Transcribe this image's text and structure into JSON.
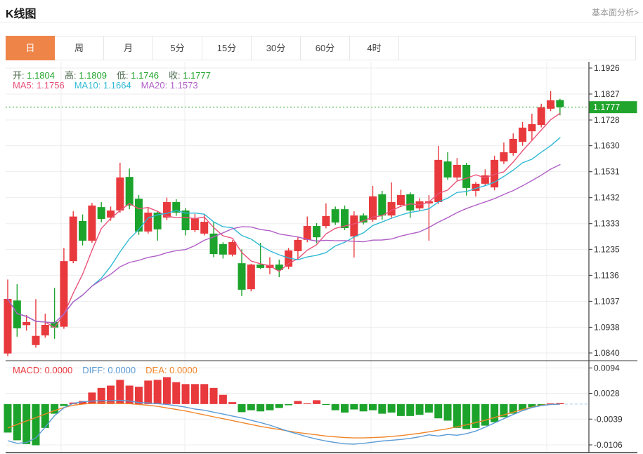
{
  "header": {
    "title": "K线图",
    "link_label": "基本面分析>"
  },
  "tabs": [
    {
      "name": "day",
      "label": "日",
      "selected": true
    },
    {
      "name": "week",
      "label": "周",
      "selected": false
    },
    {
      "name": "month",
      "label": "月",
      "selected": false
    },
    {
      "name": "m5",
      "label": "5分",
      "selected": false
    },
    {
      "name": "m15",
      "label": "15分",
      "selected": false
    },
    {
      "name": "m30",
      "label": "30分",
      "selected": false
    },
    {
      "name": "m60",
      "label": "60分",
      "selected": false
    },
    {
      "name": "h4",
      "label": "4时",
      "selected": false
    }
  ],
  "legend": {
    "ohlc": [
      {
        "label": "开:",
        "value": "1.1804"
      },
      {
        "label": "高:",
        "value": "1.1809"
      },
      {
        "label": "低:",
        "value": "1.1746"
      },
      {
        "label": "收:",
        "value": "1.1777"
      }
    ],
    "ma": [
      {
        "label": "MA5:",
        "value": "1.1756",
        "color": "#e9537a"
      },
      {
        "label": "MA10:",
        "value": "1.1664",
        "color": "#2fb9d4"
      },
      {
        "label": "MA20:",
        "value": "1.1573",
        "color": "#b05fc6"
      }
    ],
    "macd": [
      {
        "label": "MACD:",
        "value": "0.0000",
        "color": "#e8393d"
      },
      {
        "label": "DIFF:",
        "value": "0.0000",
        "color": "#5b9bd5"
      },
      {
        "label": "DEA:",
        "value": "0.0000",
        "color": "#f0862a"
      }
    ]
  },
  "colors": {
    "up": "#e8393d",
    "down": "#1ca32c",
    "ma5": "#e9537a",
    "ma10": "#2fb9d4",
    "ma20": "#b05fc6",
    "diff_line": "#5b9bd5",
    "dea_line": "#f0862a",
    "grid": "#ededed",
    "axis": "#3a3a3a",
    "tick_text": "#333333",
    "price_line": "#21a52d",
    "price_label_bg": "#21a52d",
    "ohlc_label": "#4d6b4f",
    "ohlc_value": "#21a52d",
    "dashed_zero": "#9cc8e8",
    "tab_selected_bg": "#ef8449"
  },
  "chart_data": {
    "type": "candlestick",
    "title": "K线图",
    "legend_position": "top-left",
    "grid": true,
    "main_pane": {
      "ylim": [
        1.084,
        1.1926
      ],
      "y_ticks": [
        1.1926,
        1.1827,
        1.1728,
        1.163,
        1.1531,
        1.1432,
        1.1333,
        1.1235,
        1.1136,
        1.1037,
        1.0938,
        1.084
      ],
      "last_price": 1.1777,
      "ma_periods": [
        5,
        10,
        20
      ],
      "ma_latest": {
        "MA5": 1.1756,
        "MA10": 1.1664,
        "MA20": 1.1573
      },
      "ohlc_display": {
        "open": 1.1804,
        "high": 1.1809,
        "low": 1.1746,
        "close": 1.1777
      },
      "candles_ohlc": [
        [
          1.0838,
          1.112,
          1.0828,
          1.1046
        ],
        [
          1.104,
          1.1102,
          1.0902,
          1.0934
        ],
        [
          1.0946,
          1.0985,
          1.0925,
          1.0958
        ],
        [
          1.087,
          1.1045,
          1.086,
          1.0905
        ],
        [
          1.0907,
          1.099,
          1.0898,
          1.0947
        ],
        [
          1.0958,
          1.1088,
          1.0894,
          1.0937
        ],
        [
          1.094,
          1.124,
          1.0932,
          1.119
        ],
        [
          1.119,
          1.138,
          1.1182,
          1.136
        ],
        [
          1.1343,
          1.1368,
          1.125,
          1.1268
        ],
        [
          1.1268,
          1.1412,
          1.126,
          1.1402
        ],
        [
          1.1396,
          1.1415,
          1.1338,
          1.1351
        ],
        [
          1.1356,
          1.1398,
          1.1344,
          1.1383
        ],
        [
          1.1383,
          1.1565,
          1.1375,
          1.1509
        ],
        [
          1.1511,
          1.1543,
          1.1388,
          1.1402
        ],
        [
          1.1428,
          1.1442,
          1.129,
          1.1303
        ],
        [
          1.1303,
          1.1392,
          1.1295,
          1.1375
        ],
        [
          1.1375,
          1.1382,
          1.1268,
          1.1311
        ],
        [
          1.1356,
          1.1432,
          1.1346,
          1.1415
        ],
        [
          1.1415,
          1.1426,
          1.1363,
          1.1375
        ],
        [
          1.1383,
          1.1392,
          1.1288,
          1.1308
        ],
        [
          1.1308,
          1.137,
          1.13,
          1.1352
        ],
        [
          1.1295,
          1.1368,
          1.1288,
          1.134
        ],
        [
          1.1295,
          1.134,
          1.1205,
          1.1217
        ],
        [
          1.1255,
          1.1262,
          1.12,
          1.1215
        ],
        [
          1.1215,
          1.127,
          1.1208,
          1.1263
        ],
        [
          1.1182,
          1.1235,
          1.1057,
          1.1081
        ],
        [
          1.1083,
          1.118,
          1.1075,
          1.1177
        ],
        [
          1.1177,
          1.126,
          1.116,
          1.1164
        ],
        [
          1.1164,
          1.1205,
          1.114,
          1.1176
        ],
        [
          1.1177,
          1.1196,
          1.1129,
          1.1156
        ],
        [
          1.1169,
          1.124,
          1.116,
          1.1231
        ],
        [
          1.1228,
          1.1282,
          1.1196,
          1.1271
        ],
        [
          1.1271,
          1.136,
          1.1262,
          1.1324
        ],
        [
          1.1324,
          1.1335,
          1.1258,
          1.1281
        ],
        [
          1.1324,
          1.141,
          1.1315,
          1.1362
        ],
        [
          1.1388,
          1.1398,
          1.1328,
          1.1337
        ],
        [
          1.1388,
          1.1402,
          1.1308,
          1.1316
        ],
        [
          1.1284,
          1.138,
          1.1204,
          1.1364
        ],
        [
          1.1364,
          1.1372,
          1.133,
          1.1337
        ],
        [
          1.1348,
          1.1477,
          1.134,
          1.1437
        ],
        [
          1.1445,
          1.1458,
          1.1348,
          1.1364
        ],
        [
          1.1364,
          1.149,
          1.1352,
          1.1415
        ],
        [
          1.1404,
          1.1462,
          1.1396,
          1.1442
        ],
        [
          1.1445,
          1.1452,
          1.1355,
          1.1383
        ],
        [
          1.1391,
          1.143,
          1.1382,
          1.1418
        ],
        [
          1.141,
          1.1442,
          1.1268,
          1.1418
        ],
        [
          1.1415,
          1.1629,
          1.1408,
          1.1576
        ],
        [
          1.157,
          1.1605,
          1.15,
          1.1509
        ],
        [
          1.1509,
          1.1583,
          1.1498,
          1.1557
        ],
        [
          1.1557,
          1.1565,
          1.144,
          1.1469
        ],
        [
          1.1458,
          1.1492,
          1.1436,
          1.1485
        ],
        [
          1.1485,
          1.154,
          1.1476,
          1.1517
        ],
        [
          1.1471,
          1.1592,
          1.146,
          1.1576
        ],
        [
          1.157,
          1.1642,
          1.156,
          1.1605
        ],
        [
          1.1602,
          1.1677,
          1.1592,
          1.1656
        ],
        [
          1.1645,
          1.172,
          1.163,
          1.1699
        ],
        [
          1.1685,
          1.1752,
          1.165,
          1.1712
        ],
        [
          1.1709,
          1.179,
          1.17,
          1.1776
        ],
        [
          1.1771,
          1.1838,
          1.1762,
          1.1803
        ],
        [
          1.1804,
          1.1809,
          1.1746,
          1.1777
        ]
      ]
    },
    "macd_pane": {
      "ylim": [
        -0.0106,
        0.0094
      ],
      "y_ticks": [
        0.0094,
        0.0028,
        -0.0039,
        -0.0106
      ],
      "macd_display": {
        "MACD": 0.0,
        "DIFF": 0.0,
        "DEA": 0.0
      },
      "histogram": [
        -0.0074,
        -0.0094,
        -0.0104,
        -0.0107,
        -0.0062,
        -0.0025,
        -0.0005,
        0.0004,
        0.0008,
        0.003,
        0.0042,
        0.0048,
        0.0063,
        0.0048,
        0.0045,
        0.0061,
        0.0063,
        0.007,
        0.0057,
        0.0052,
        0.0052,
        0.0052,
        0.0042,
        0.0024,
        0.0005,
        -0.0021,
        -0.0016,
        -0.0019,
        -0.0016,
        -0.001,
        -0.0003,
        0.0008,
        0.0002,
        0.001,
        -0.0002,
        -0.0016,
        -0.0022,
        -0.0014,
        -0.0019,
        -0.0016,
        -0.0025,
        -0.0022,
        -0.0031,
        -0.0031,
        -0.0028,
        -0.0022,
        -0.0037,
        -0.0043,
        -0.0062,
        -0.0065,
        -0.0062,
        -0.0056,
        -0.0047,
        -0.0034,
        -0.0025,
        -0.0016,
        -0.0008,
        -0.0004,
        0.0002,
        0.0003
      ],
      "diff": [
        -0.0095,
        -0.0102,
        -0.01,
        -0.0088,
        -0.006,
        -0.003,
        -0.001,
        0.0002,
        0.0006,
        0.0008,
        0.0009,
        0.0009,
        0.001,
        0.0008,
        0.0004,
        0.0003,
        0.0001,
        -0.0001,
        -0.0004,
        -0.0008,
        -0.0013,
        -0.0016,
        -0.0021,
        -0.0026,
        -0.0031,
        -0.0036,
        -0.0042,
        -0.0048,
        -0.0055,
        -0.0063,
        -0.0071,
        -0.0078,
        -0.0085,
        -0.0091,
        -0.0096,
        -0.01,
        -0.0103,
        -0.0104,
        -0.0102,
        -0.0099,
        -0.0096,
        -0.0094,
        -0.0092,
        -0.0089,
        -0.0085,
        -0.008,
        -0.0083,
        -0.0079,
        -0.0081,
        -0.0077,
        -0.007,
        -0.006,
        -0.0049,
        -0.0038,
        -0.0027,
        -0.0017,
        -0.0009,
        -0.0004,
        -0.0001,
        0.0
      ],
      "dea": [
        -0.0062,
        -0.0053,
        -0.0044,
        -0.0035,
        -0.0026,
        -0.0017,
        -0.0009,
        -0.0003,
        0.0,
        0.0002,
        0.0003,
        0.0003,
        0.0002,
        0.0001,
        -0.0001,
        -0.0003,
        -0.0006,
        -0.001,
        -0.0014,
        -0.0018,
        -0.0023,
        -0.0028,
        -0.0033,
        -0.0038,
        -0.0043,
        -0.0048,
        -0.0053,
        -0.0058,
        -0.0062,
        -0.0066,
        -0.007,
        -0.0074,
        -0.0077,
        -0.008,
        -0.0083,
        -0.0085,
        -0.0087,
        -0.0088,
        -0.0088,
        -0.0087,
        -0.0086,
        -0.0084,
        -0.0082,
        -0.0079,
        -0.0076,
        -0.0072,
        -0.0068,
        -0.0064,
        -0.0059,
        -0.0054,
        -0.0048,
        -0.0042,
        -0.0035,
        -0.0028,
        -0.0021,
        -0.0014,
        -0.0008,
        -0.0003,
        -0.0001,
        0.0
      ]
    },
    "v_gridlines_x": [
      87,
      263,
      528,
      778
    ]
  }
}
